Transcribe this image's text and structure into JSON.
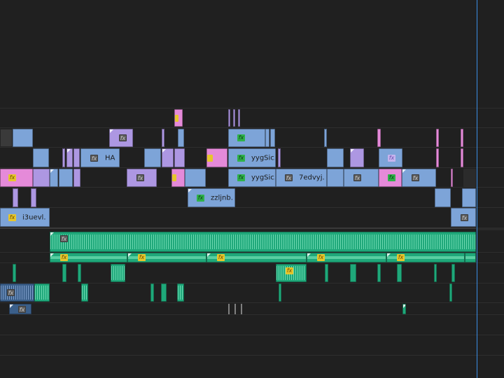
{
  "timeline": {
    "playhead_label": "",
    "clip_labels": {
      "ha": "HA",
      "yyg1": "yygSic.",
      "yyg2": "yygSic.",
      "sedvyj": "7edvyj.",
      "zzljnb": "zzljnb.",
      "ibuevl": "i3uevl."
    },
    "fx_badge": "fx",
    "colors": {
      "background": "#202020",
      "video_blue": "#7da4d8",
      "video_purple": "#ad97e2",
      "video_pink": "#e58ad9",
      "audio_green": "#1fa87a",
      "audio_blue": "#3b5f8a",
      "playhead": "#3a8ee6"
    }
  }
}
